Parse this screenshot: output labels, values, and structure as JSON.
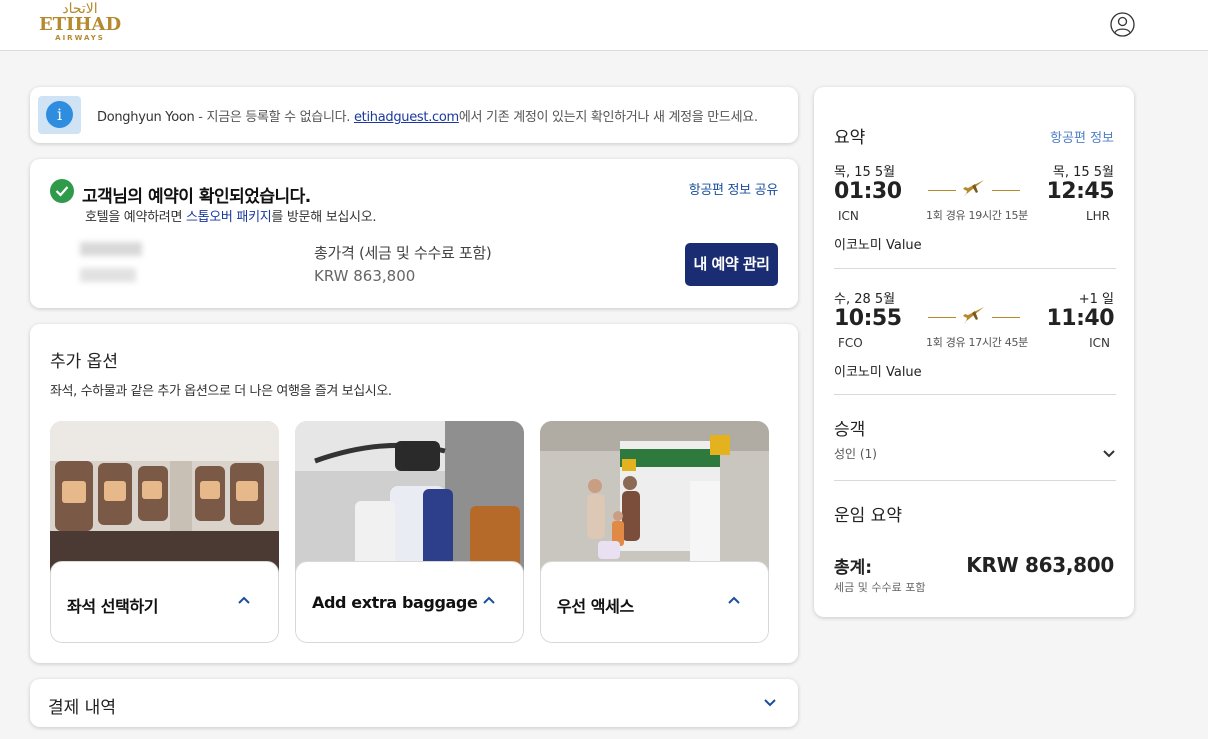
{
  "header": {
    "logo_arabic": "الاتحاد",
    "logo_name": "ETIHAD",
    "logo_sub": "AIRWAYS",
    "user_icon": "user-circle-icon"
  },
  "info_banner": {
    "icon": "info-icon",
    "name": "Donghyun Yoon",
    "sep": " - ",
    "text_before": "지금은 등록할 수 없습니다. ",
    "link": "etihadguest.com",
    "text_after": "에서 기존 계정이 있는지 확인하거나 새 계정을 만드세요."
  },
  "confirmation": {
    "icon": "check-circle-icon",
    "title": "고객님의 예약이 확인되었습니다.",
    "subtitle_before": "호텔을 예약하려면 ",
    "subtitle_link": "스톱오버 패키지",
    "subtitle_after": "를 방문해 보십시오.",
    "share_link": "항공편 정보 공유",
    "price_label": "총가격 (세금 및 수수료 포함)",
    "price_value": "KRW  863,800",
    "manage_button": "내 예약 관리"
  },
  "extras": {
    "title": "추가 옵션",
    "subtitle": "좌석, 수하물과 같은 추가 옵션으로 더 나은 여행을 즐겨 보십시오.",
    "cards": [
      {
        "label": "좌석 선택하기"
      },
      {
        "label": "Add extra baggage"
      },
      {
        "label": "우선 액세스"
      }
    ]
  },
  "payment": {
    "title": "결제 내역"
  },
  "summary": {
    "title": "요약",
    "flight_info_link": "항공편 정보",
    "segments": [
      {
        "dep_date": "목, 15 5월",
        "arr_date": "목, 15 5월",
        "dep_time": "01:30",
        "arr_time": "12:45",
        "dep_airport": "ICN",
        "arr_airport": "LHR",
        "stops": "1회 경유 19시간 15분",
        "cabin": "이코노미 Value"
      },
      {
        "dep_date": "수, 28 5월",
        "arr_date": "+1 일",
        "dep_time": "10:55",
        "arr_time": "11:40",
        "dep_airport": "FCO",
        "arr_airport": "ICN",
        "stops": "1회 경유 17시간 45분",
        "cabin": "이코노미 Value"
      }
    ],
    "passengers_title": "승객",
    "passengers_sub": "성인 (1)",
    "fare_title": "운임 요약",
    "total_label": "총계:",
    "total_value": "KRW  863,800",
    "tax_note": "세금 및 수수료 포함"
  },
  "colors": {
    "brand_gold": "#b58a2e",
    "manage_button_bg": "#1b2d72",
    "link_blue": "#1a3aa0",
    "success_green": "#2e9a4a",
    "info_blue": "#2f8de0"
  }
}
